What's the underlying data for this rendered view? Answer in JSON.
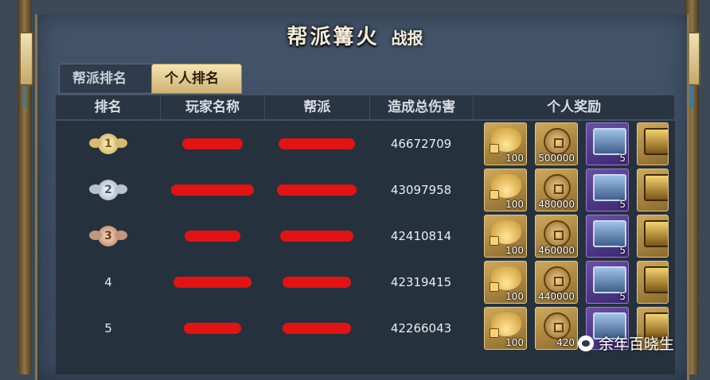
{
  "title": "帮派篝火",
  "subtitle": "战报",
  "tabs": [
    {
      "label": "帮派排名",
      "active": false
    },
    {
      "label": "个人排名",
      "active": true
    }
  ],
  "columns": [
    "排名",
    "玩家名称",
    "帮派",
    "造成总伤害",
    "个人奖励"
  ],
  "rows": [
    {
      "rank": "1",
      "rank_style": "gold",
      "damage": "46672709",
      "rewards": [
        {
          "icon": "gold-ingot-icon",
          "qty": "100"
        },
        {
          "icon": "copper-coin-icon",
          "qty": "500000"
        },
        {
          "icon": "blue-chest-icon",
          "qty": "5"
        }
      ]
    },
    {
      "rank": "2",
      "rank_style": "silver",
      "damage": "43097958",
      "rewards": [
        {
          "icon": "gold-ingot-icon",
          "qty": "100"
        },
        {
          "icon": "copper-coin-icon",
          "qty": "480000"
        },
        {
          "icon": "blue-chest-icon",
          "qty": "5"
        }
      ]
    },
    {
      "rank": "3",
      "rank_style": "bronze",
      "damage": "42410814",
      "rewards": [
        {
          "icon": "gold-ingot-icon",
          "qty": "100"
        },
        {
          "icon": "copper-coin-icon",
          "qty": "460000"
        },
        {
          "icon": "blue-chest-icon",
          "qty": "5"
        }
      ]
    },
    {
      "rank": "4",
      "rank_style": "plain",
      "damage": "42319415",
      "rewards": [
        {
          "icon": "gold-ingot-icon",
          "qty": "100"
        },
        {
          "icon": "copper-coin-icon",
          "qty": "440000"
        },
        {
          "icon": "blue-chest-icon",
          "qty": "5"
        }
      ]
    },
    {
      "rank": "5",
      "rank_style": "plain",
      "damage": "42266043",
      "rewards": [
        {
          "icon": "gold-ingot-icon",
          "qty": "100"
        },
        {
          "icon": "copper-coin-icon",
          "qty": "420"
        },
        {
          "icon": "blue-chest-icon",
          "qty": "5"
        }
      ]
    }
  ],
  "watermark": "余年百晓生",
  "colors": {
    "accent_gold": "#cfa85a",
    "redaction": "#e21313",
    "panel": "#26313e"
  }
}
